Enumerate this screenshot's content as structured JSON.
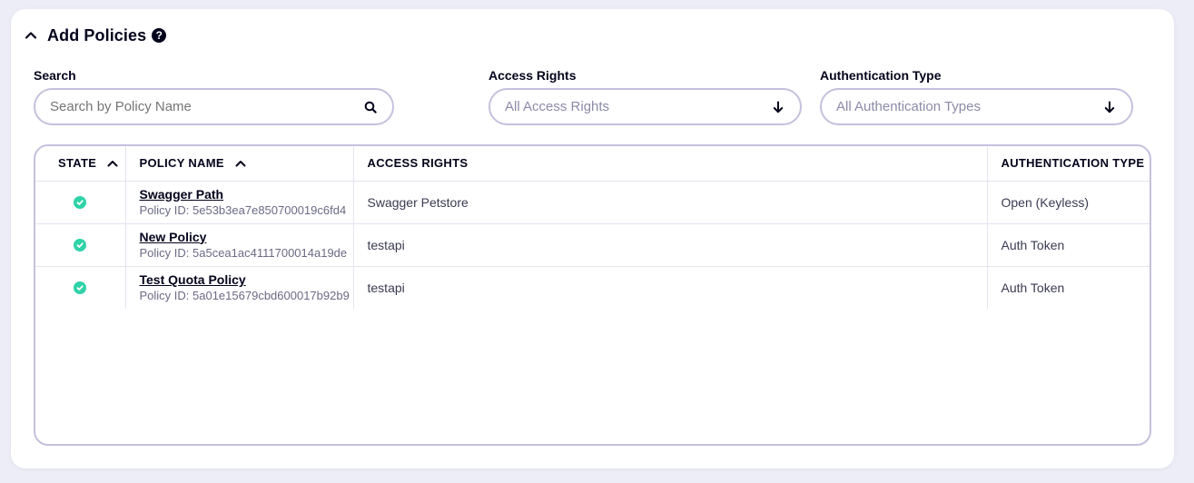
{
  "panel": {
    "title": "Add Policies",
    "help": "?"
  },
  "filters": {
    "search": {
      "label": "Search",
      "placeholder": "Search by Policy Name"
    },
    "access_rights": {
      "label": "Access Rights",
      "value": "All Access Rights"
    },
    "auth_type": {
      "label": "Authentication Type",
      "value": "All Authentication Types"
    }
  },
  "table": {
    "headers": {
      "state": "State",
      "policy_name": "Policy Name",
      "access_rights": "Access Rights",
      "auth_type": "Authentication Type"
    },
    "rows": [
      {
        "state": "active",
        "name": "Swagger Path",
        "policy_id": "Policy ID: 5e53b3ea7e850700019c6fd4",
        "access_rights": "Swagger Petstore",
        "auth_type": "Open (Keyless)"
      },
      {
        "state": "active",
        "name": "New Policy",
        "policy_id": "Policy ID: 5a5cea1ac4111700014a19de",
        "access_rights": "testapi",
        "auth_type": "Auth Token"
      },
      {
        "state": "active",
        "name": "Test Quota Policy",
        "policy_id": "Policy ID: 5a01e15679cbd600017b92b9",
        "access_rights": "testapi",
        "auth_type": "Auth Token"
      }
    ]
  },
  "colors": {
    "background": "#ededf7",
    "panel": "#ffffff",
    "border": "#c4c1dd",
    "status_active": "#2fd3a8",
    "text_dark": "#03031c"
  },
  "icons": {
    "collapse": "chevron-up-icon",
    "help": "question-circle-icon",
    "search": "search-icon",
    "dropdown": "arrow-down-icon",
    "sort": "chevron-up-icon",
    "status": "check-circle-icon"
  }
}
